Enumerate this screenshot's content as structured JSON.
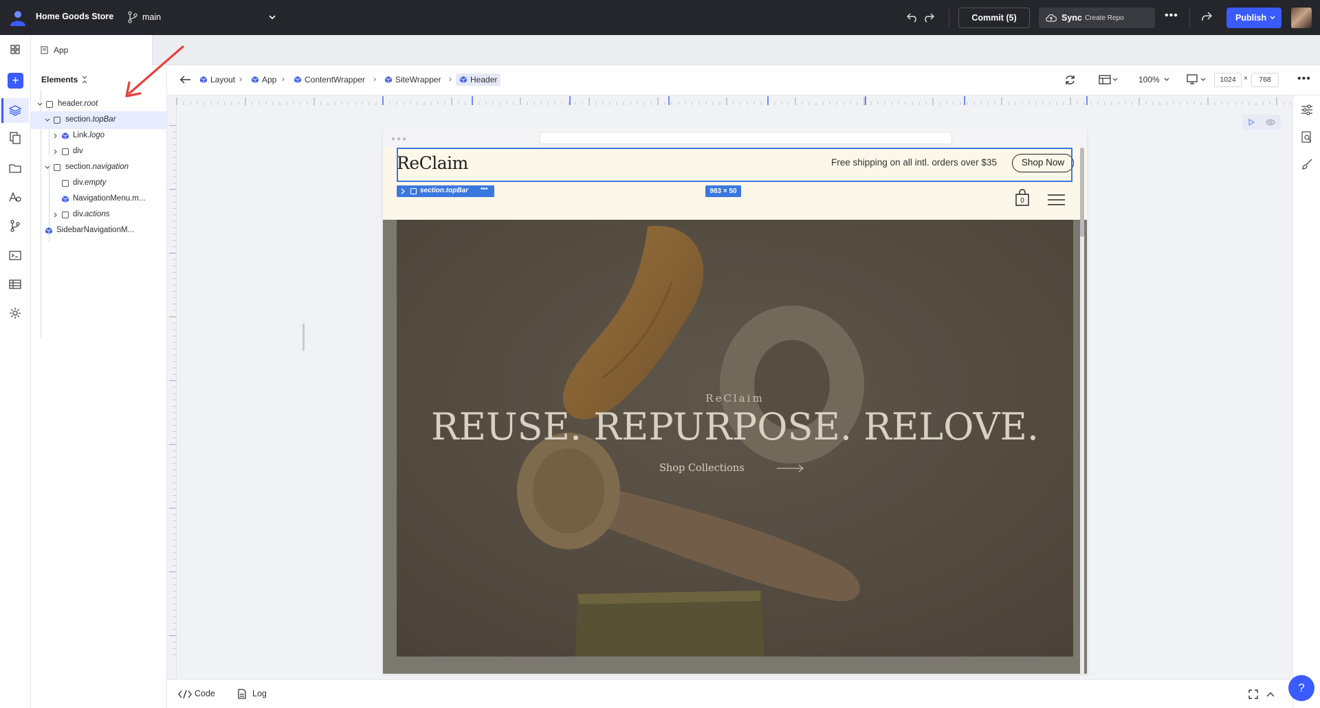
{
  "topbar": {
    "project_name": "Home Goods Store",
    "branch": "main",
    "commit_label": "Commit (5)",
    "sync_label": "Sync",
    "sync_sub": "Create Repo",
    "more_label": "•••",
    "publish_label": "Publish"
  },
  "tab": {
    "label": "App"
  },
  "elements_panel": {
    "title": "Elements",
    "tree": [
      {
        "prefix": "header.",
        "name": "root"
      },
      {
        "prefix": "section.",
        "name": "topBar"
      },
      {
        "prefix": "Link.",
        "name": "logo"
      },
      {
        "prefix": "",
        "name": "div"
      },
      {
        "prefix": "section.",
        "name": "navigation"
      },
      {
        "prefix": "div.",
        "name": "empty"
      },
      {
        "prefix": "",
        "name": "NavigationMenu.m..."
      },
      {
        "prefix": "div.",
        "name": "actions"
      },
      {
        "prefix": "",
        "name": "SidebarNavigationM..."
      }
    ]
  },
  "breadcrumbs": [
    "Layout",
    "App",
    "ContentWrapper",
    "SiteWrapper",
    "Header"
  ],
  "canvas_toolbar": {
    "zoom": "100%",
    "width": "1024",
    "height": "768",
    "times": "×"
  },
  "site": {
    "brand": "ReClaim",
    "shipping_text": "Free shipping on all intl. orders over $35",
    "shop_now": "Shop Now",
    "cart_count": "0",
    "selection_tag": "section.topBar",
    "selection_dims": "983 × 50",
    "hero_kicker": "ReClaim",
    "hero_headline": "REUSE. REPURPOSE. RELOVE.",
    "hero_cta": "Shop Collections"
  },
  "bottom": {
    "code_label": "Code",
    "log_label": "Log"
  },
  "help_label": "?",
  "colors": {
    "accent": "#3a5bff",
    "selection": "#3a78e0",
    "topbar_bg": "#25262b"
  }
}
